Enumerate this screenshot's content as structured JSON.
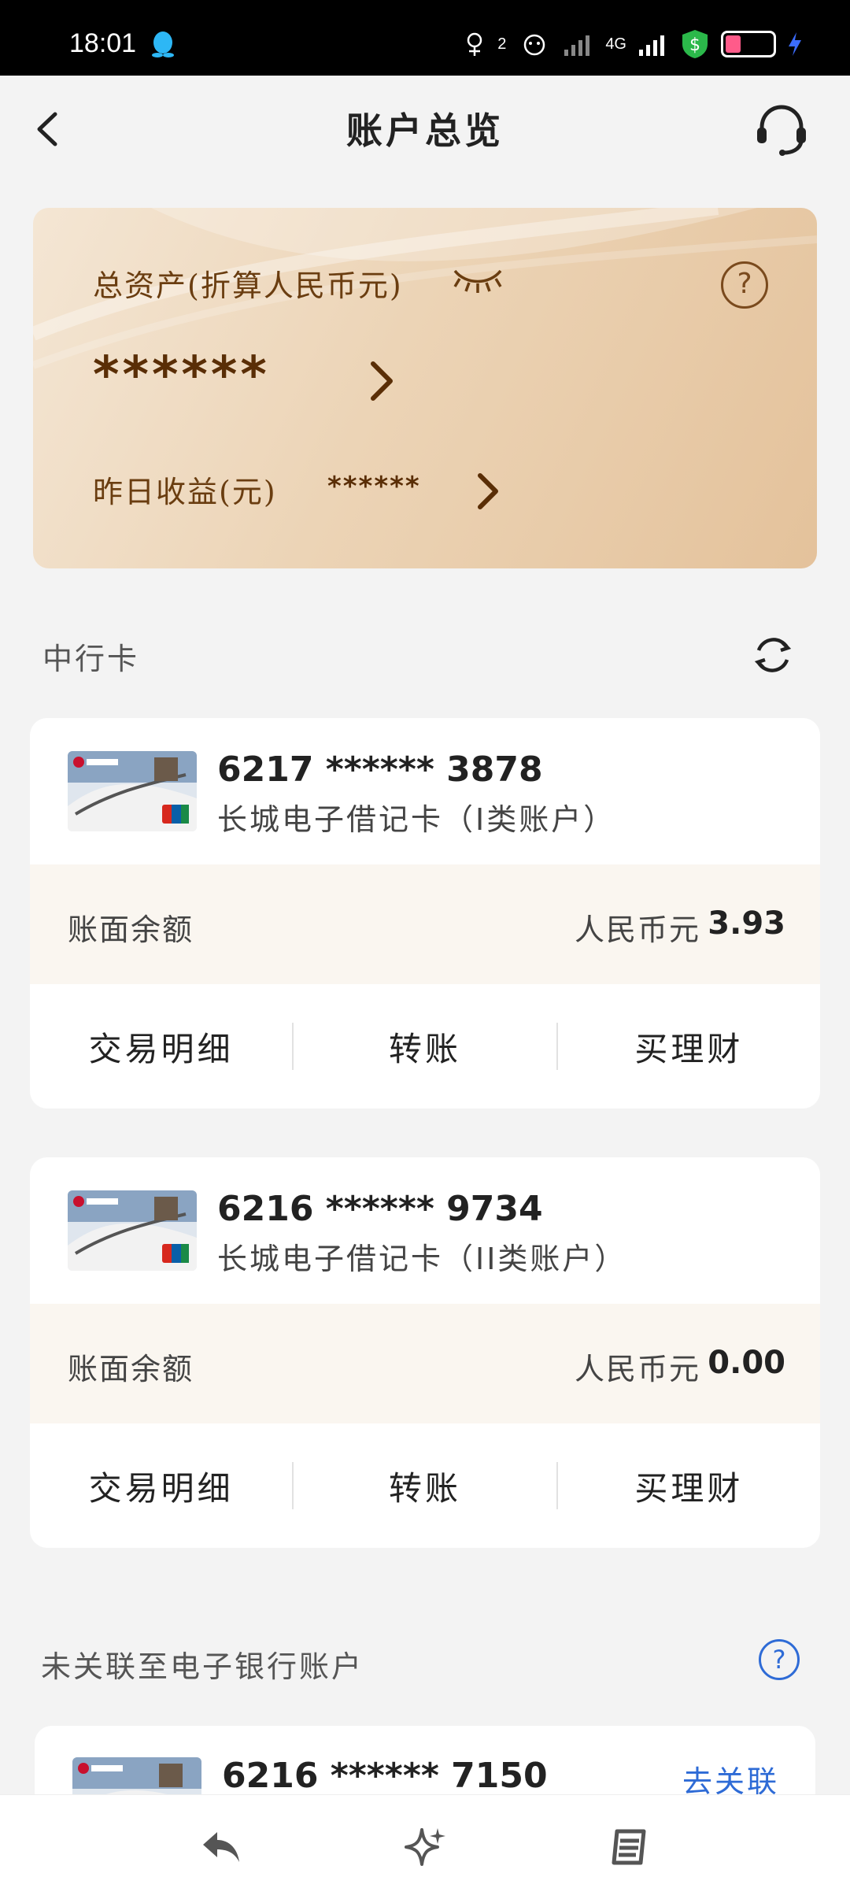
{
  "status_bar": {
    "time": "18:01",
    "sim2": "2",
    "net": "4G"
  },
  "header": {
    "title": "账户总览"
  },
  "assets": {
    "total_label": "总资产(折算人民币元)",
    "total_value": "******",
    "yesterday_label": "昨日收益(元)",
    "yesterday_value": "******"
  },
  "bank_cards_section": {
    "title": "中行卡",
    "cards": [
      {
        "number": "6217 ****** 3878",
        "type": "长城电子借记卡（I类账户）",
        "balance_label": "账面余额",
        "currency": "人民币元",
        "balance": "3.93",
        "actions": [
          "交易明细",
          "转账",
          "买理财"
        ]
      },
      {
        "number": "6216 ****** 9734",
        "type": "长城电子借记卡（II类账户）",
        "balance_label": "账面余额",
        "currency": "人民币元",
        "balance": "0.00",
        "actions": [
          "交易明细",
          "转账",
          "买理财"
        ]
      }
    ]
  },
  "unlinked_section": {
    "title": "未关联至电子银行账户",
    "card_number": "6216 ****** 7150",
    "link_label": "去关联"
  },
  "bottom_nav": {
    "icons": [
      "back-arrow-icon",
      "sparkle-icon",
      "list-icon"
    ]
  },
  "colors": {
    "accent_brown": "#6a3d10",
    "link_blue": "#2e6bd6",
    "balance_bg": "#faf6f0"
  }
}
